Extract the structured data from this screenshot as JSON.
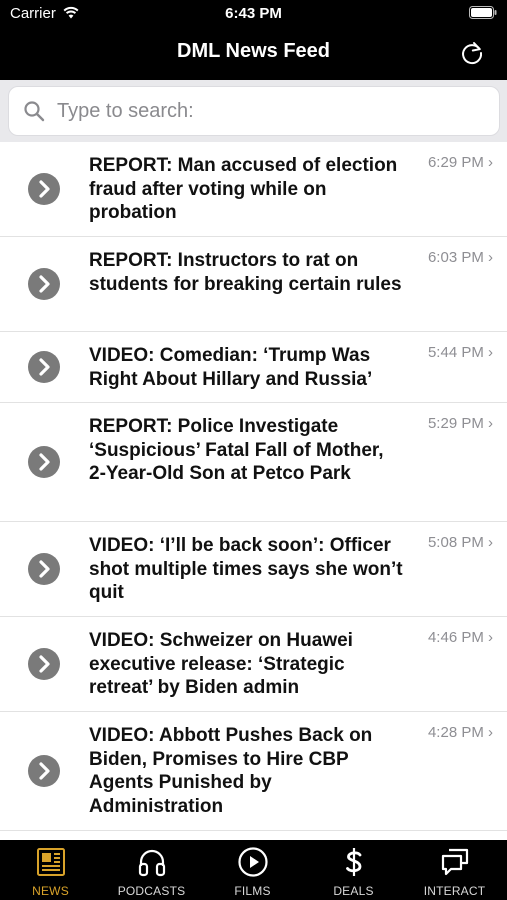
{
  "status_bar": {
    "carrier": "Carrier",
    "time": "6:43 PM"
  },
  "nav": {
    "title": "DML News Feed",
    "refresh_icon": "refresh-icon"
  },
  "search": {
    "placeholder": "Type to search:",
    "value": ""
  },
  "feed": {
    "items": [
      {
        "headline": "REPORT: Man accused of election fraud after voting while on probation",
        "time": "6:29 PM ›"
      },
      {
        "headline": "REPORT: Instructors to rat on students for breaking certain rules",
        "time": "6:03 PM ›"
      },
      {
        "headline": "VIDEO: Comedian: ‘Trump Was Right About Hillary and Russia’",
        "time": "5:44 PM ›"
      },
      {
        "headline": "REPORT: Police Investigate ‘Suspicious’ Fatal Fall of Mother, 2-Year-Old Son at Petco Park",
        "time": "5:29 PM ›"
      },
      {
        "headline": "VIDEO: ‘I’ll be back soon’: Officer shot multiple times says she won’t quit",
        "time": "5:08 PM ›"
      },
      {
        "headline": "VIDEO: Schweizer on Huawei executive release: ‘Strategic retreat’ by Biden admin",
        "time": "4:46 PM ›"
      },
      {
        "headline": "VIDEO: Abbott Pushes Back on Biden, Promises to Hire CBP Agents Punished by Administration",
        "time": "4:28 PM ›"
      }
    ]
  },
  "tabs": [
    {
      "label": "NEWS",
      "icon": "newspaper-icon",
      "active": true
    },
    {
      "label": "PODCASTS",
      "icon": "headphones-icon",
      "active": false
    },
    {
      "label": "FILMS",
      "icon": "play-circle-icon",
      "active": false
    },
    {
      "label": "DEALS",
      "icon": "dollar-icon",
      "active": false
    },
    {
      "label": "INTERACT",
      "icon": "chat-bubbles-icon",
      "active": false
    }
  ],
  "colors": {
    "accent": "#d9a32a",
    "header_bg": "#000000",
    "chevron_bg": "#7a7a7a"
  }
}
